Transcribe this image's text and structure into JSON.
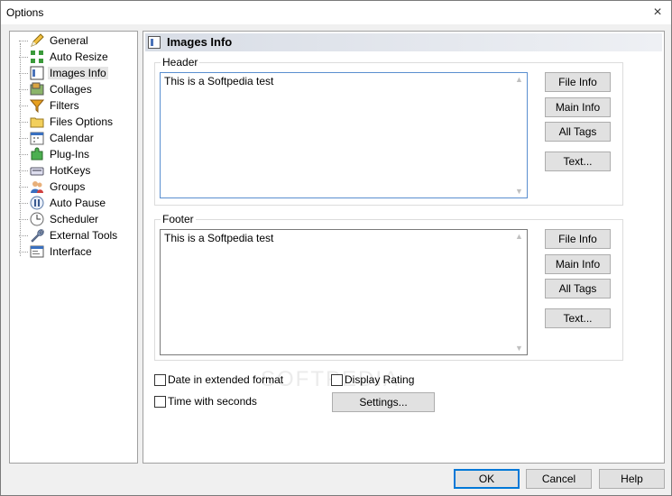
{
  "window": {
    "title": "Options"
  },
  "icons": {
    "close": "×"
  },
  "tree": {
    "items": [
      {
        "label": "General",
        "icon": "pencil-icon"
      },
      {
        "label": "Auto Resize",
        "icon": "resize-icon"
      },
      {
        "label": "Images Info",
        "icon": "info-window-icon",
        "selected": true
      },
      {
        "label": "Collages",
        "icon": "collage-icon"
      },
      {
        "label": "Filters",
        "icon": "filter-icon"
      },
      {
        "label": "Files Options",
        "icon": "folder-icon"
      },
      {
        "label": "Calendar",
        "icon": "calendar-icon"
      },
      {
        "label": "Plug-Ins",
        "icon": "puzzle-icon"
      },
      {
        "label": "HotKeys",
        "icon": "keyboard-icon"
      },
      {
        "label": "Groups",
        "icon": "users-icon"
      },
      {
        "label": "Auto Pause",
        "icon": "pause-icon"
      },
      {
        "label": "Scheduler",
        "icon": "clock-icon"
      },
      {
        "label": "External Tools",
        "icon": "wrench-icon"
      },
      {
        "label": "Interface",
        "icon": "interface-icon"
      }
    ]
  },
  "panel": {
    "title": "Images Info",
    "header": {
      "label": "Header",
      "text": "This is a Softpedia test",
      "buttons": [
        "File Info",
        "Main Info",
        "All Tags",
        "Text..."
      ]
    },
    "footer": {
      "label": "Footer",
      "text": "This is a Softpedia test",
      "buttons": [
        "File Info",
        "Main Info",
        "All Tags",
        "Text..."
      ]
    },
    "options": {
      "date_extended": {
        "label": "Date in extended format",
        "checked": false
      },
      "time_seconds": {
        "label": "Time with seconds",
        "checked": false
      },
      "display_rating": {
        "label": "Display Rating",
        "checked": false
      },
      "settings_label": "Settings..."
    },
    "watermark": "SOFTPEDIA"
  },
  "footer_buttons": {
    "ok": "OK",
    "cancel": "Cancel",
    "help": "Help"
  }
}
